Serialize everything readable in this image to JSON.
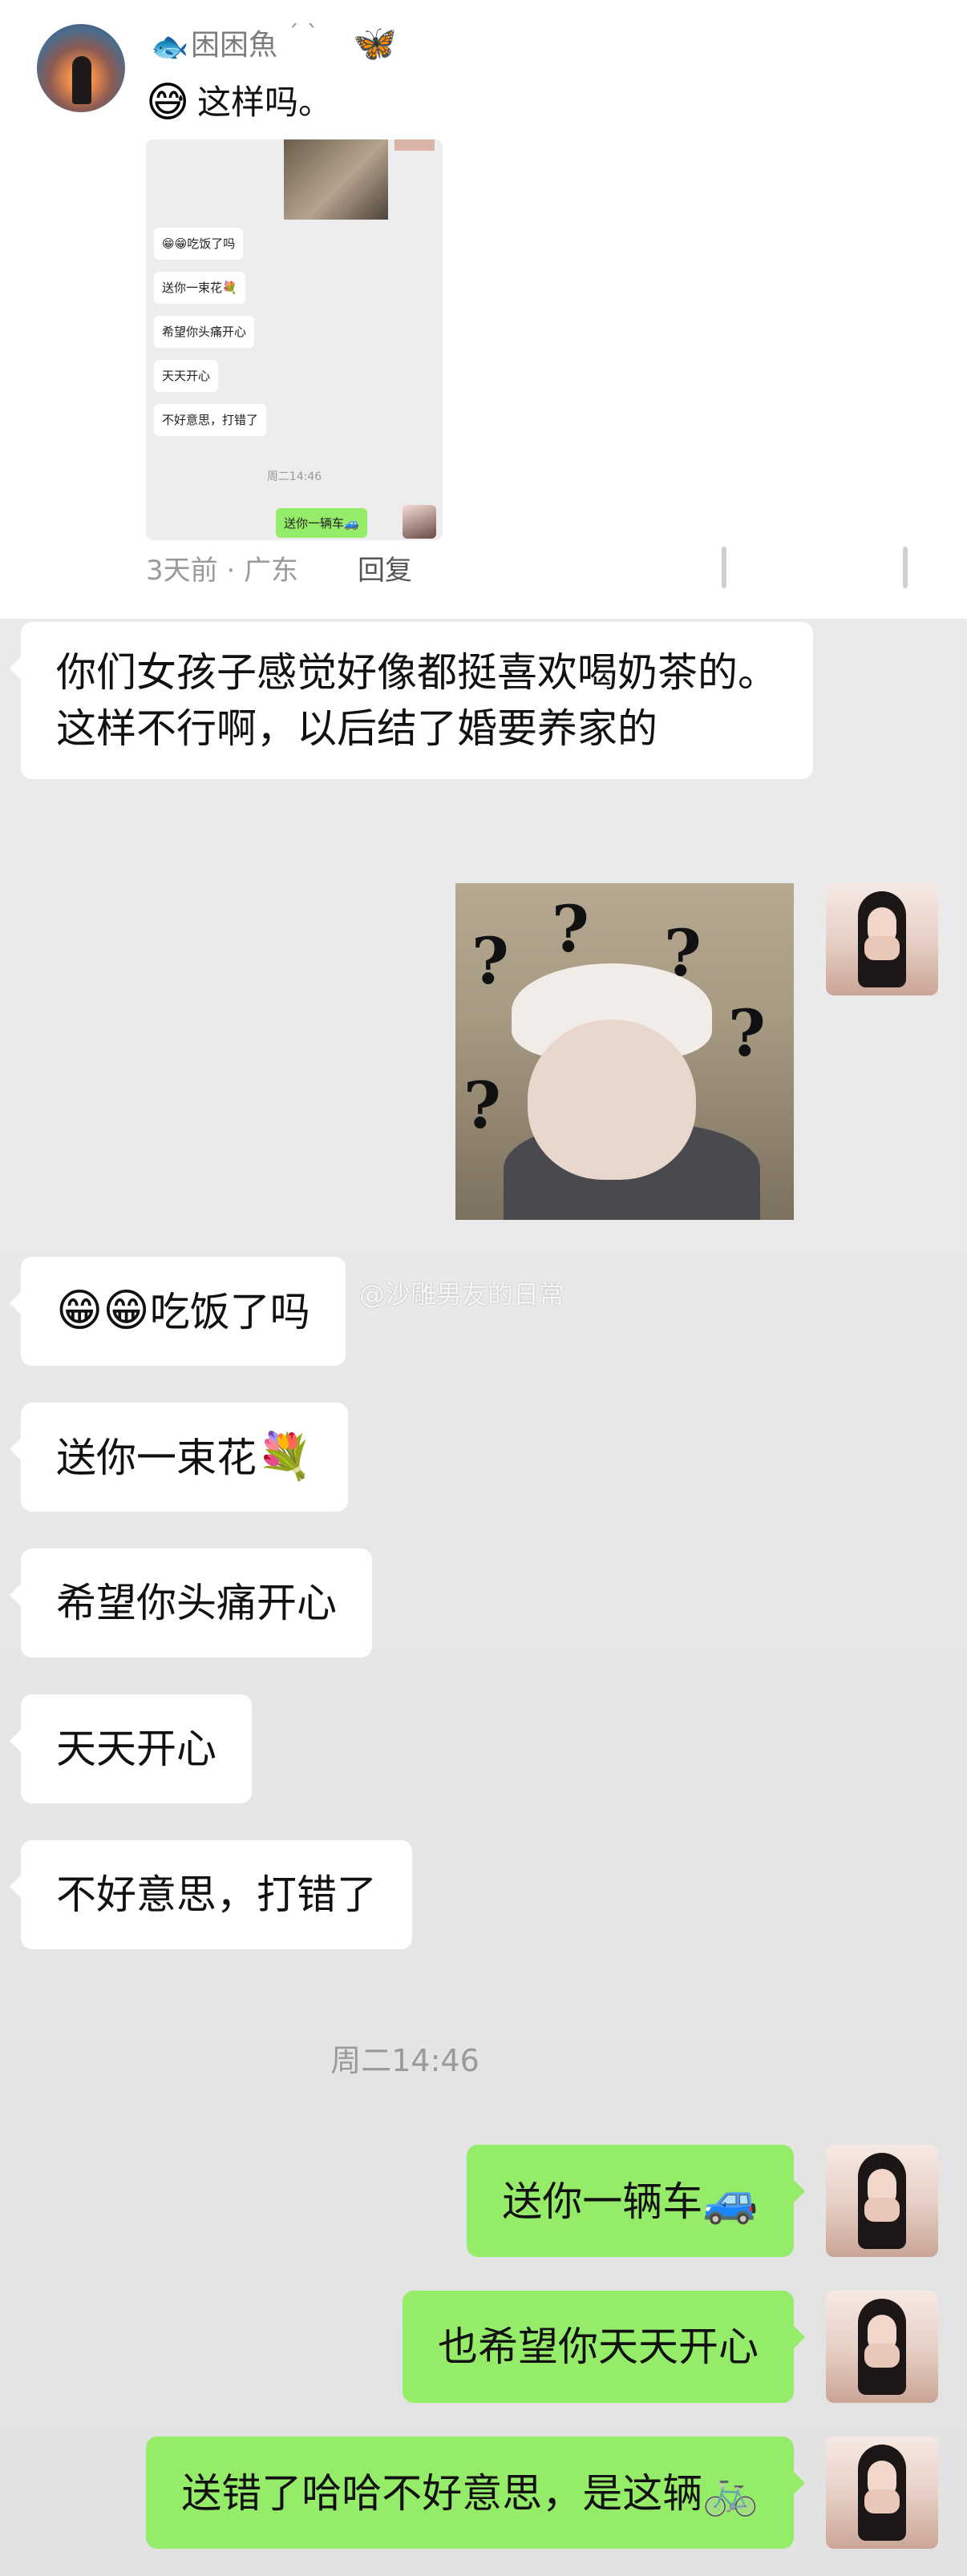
{
  "comment": {
    "username": "困困魚",
    "name_mark": "ˊ ˋ",
    "comment_emoji": "😅",
    "comment_text": "这样吗。",
    "time_location": "3天前 · 广东",
    "reply_label": "回复",
    "thumbnail": {
      "bubbles": [
        "😁😁吃饭了吗",
        "送你一束花💐",
        "希望你头痛开心",
        "天天开心",
        "不好意思，打错了"
      ],
      "time": "周二14:46",
      "green_bubble": "送你一辆车🚙"
    }
  },
  "chat": {
    "incoming_1": "你们女孩子感觉好像都挺喜欢喝奶茶的。这样不行啊，以后结了婚要养家的",
    "incoming_2_emoji": "😁😁",
    "incoming_2_text": "吃饭了吗",
    "incoming_3_text": "送你一束花",
    "incoming_3_emoji": "💐",
    "incoming_4": "希望你头痛开心",
    "incoming_5": "天天开心",
    "incoming_6": "不好意思，打错了",
    "time_divider": "周二14:46",
    "outgoing_1_text": "送你一辆车",
    "outgoing_1_emoji": "🚙",
    "outgoing_2": "也希望你天天开心",
    "outgoing_3_text": "送错了哈哈不好意思，是这辆",
    "outgoing_3_emoji": "🚲",
    "watermark": "@沙雕男友的日常"
  },
  "icons": {
    "fish": "fish-icon",
    "butterfly": "butterfly-icon",
    "sticker_question_mark": "?"
  },
  "colors": {
    "green_bubble": "#95ec69",
    "white_bubble": "#ffffff",
    "background": "#ebebeb"
  }
}
